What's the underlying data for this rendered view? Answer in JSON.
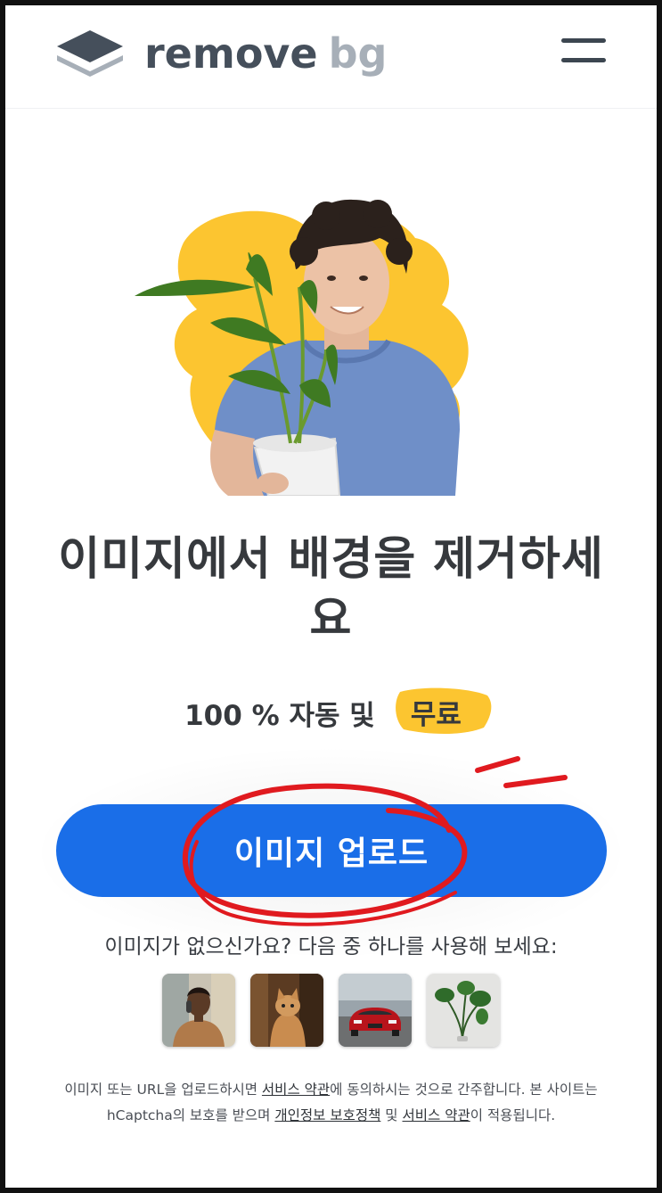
{
  "brand": {
    "name_part1": "remove",
    "name_part2": "bg",
    "accent_color": "#1a6ee8",
    "highlight_color": "#fcc530"
  },
  "header": {
    "menu_icon": "hamburger-menu-icon"
  },
  "hero": {
    "title": "이미지에서 배경을 제거하세요",
    "subtitle_prefix": "100 % 자동 및",
    "subtitle_highlight": "무료"
  },
  "upload": {
    "label": "이미지 업로드"
  },
  "samples": {
    "label": "이미지가 없으신가요? 다음 중 하나를 사용해 보세요:",
    "items": [
      "sample-person",
      "sample-cat",
      "sample-car",
      "sample-plant"
    ]
  },
  "legal": {
    "part1": "이미지 또는 URL을 업로드하시면 ",
    "terms_link": "서비스 약관",
    "part2": "에 동의하시는 것으로 간주합니다. 본 사이트는 hCaptcha의 보호를 받으며 ",
    "privacy_link": "개인정보 보호정책",
    "part3": " 및 ",
    "terms_link2": "서비스 약관",
    "part4": "이 적용됩니다."
  }
}
